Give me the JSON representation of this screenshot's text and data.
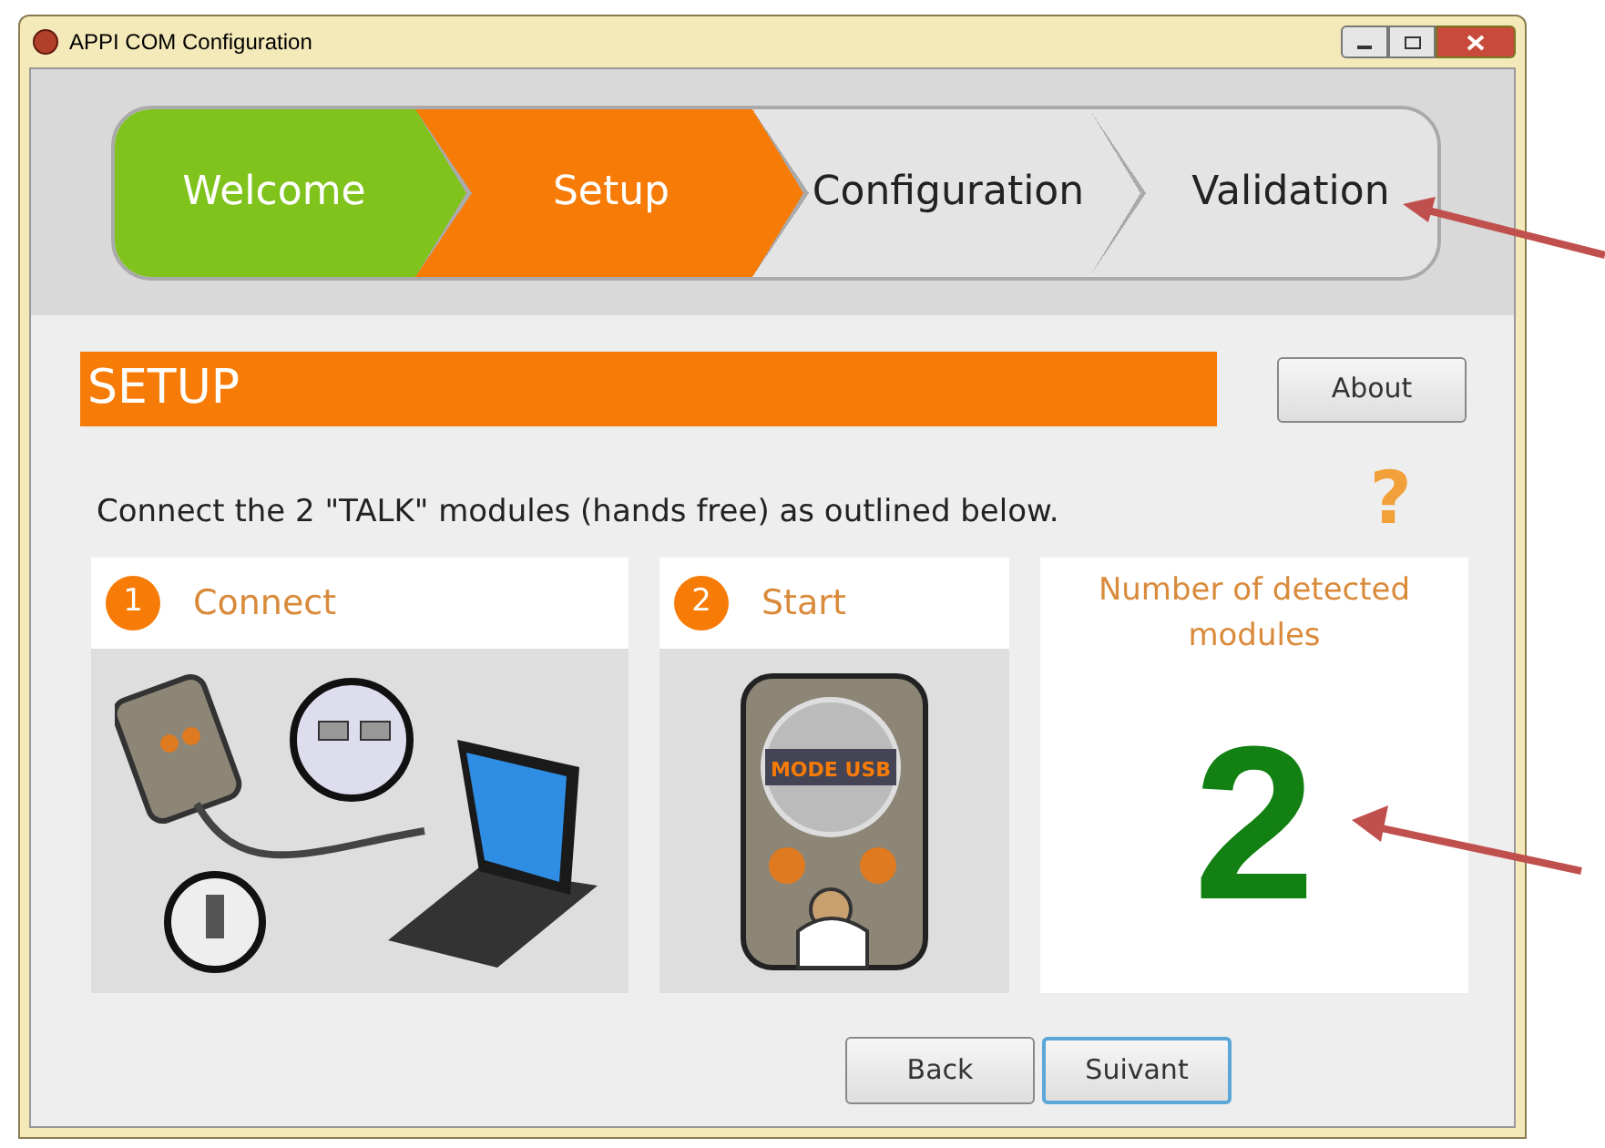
{
  "window": {
    "title": "APPI COM Configuration"
  },
  "steps": [
    {
      "label": "Welcome",
      "done": true,
      "selected": false
    },
    {
      "label": "Setup",
      "done": false,
      "selected": true
    },
    {
      "label": "Configuration",
      "done": false,
      "selected": false
    },
    {
      "label": "Validation",
      "done": false,
      "selected": false
    }
  ],
  "help_icon": "?",
  "section_title": "SETUP",
  "about_button": "About",
  "instruction": "Connect the 2 \"TALK\" modules (hands free) as outlined below.",
  "cards": [
    {
      "kind": "connect",
      "number": "1",
      "title": "Connect"
    },
    {
      "kind": "start",
      "number": "2",
      "title": "Start",
      "screen_label": "MODE USB"
    }
  ],
  "detected": {
    "label": "Number of detected modules",
    "count": "2"
  },
  "buttons": [
    {
      "label": "Back",
      "focused": false
    },
    {
      "label": "Suivant",
      "focused": true
    }
  ]
}
